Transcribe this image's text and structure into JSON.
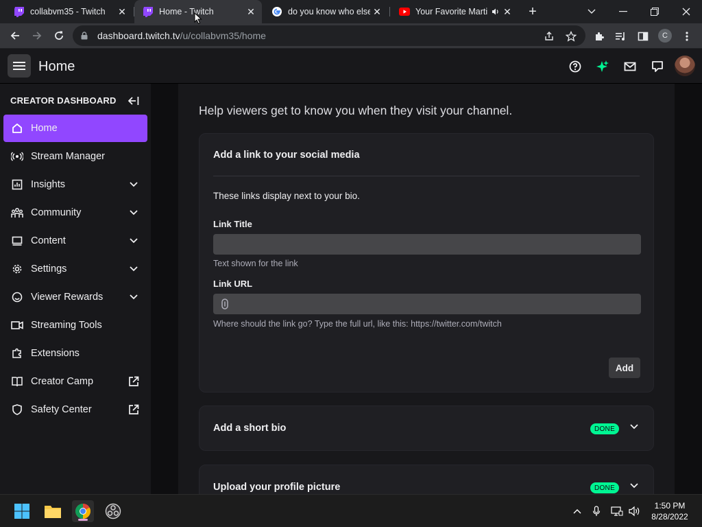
{
  "browser": {
    "tabs": [
      {
        "title": "collabvm35 - Twitch",
        "favicon": "twitch-icon",
        "active": false
      },
      {
        "title": "Home - Twitch",
        "favicon": "twitch-icon",
        "active": true
      },
      {
        "title": "do you know who else",
        "favicon": "google-icon",
        "active": false
      },
      {
        "title": "Your Favorite Marti",
        "favicon": "youtube-icon",
        "active": false
      }
    ],
    "url_host": "dashboard.twitch.tv",
    "url_path": "/u/collabvm35/home",
    "profile_initial": "C"
  },
  "topnav": {
    "title": "Home"
  },
  "sidebar": {
    "header": "CREATOR DASHBOARD",
    "items": [
      {
        "label": "Home",
        "icon": "home-icon",
        "active": true,
        "trailing": "none"
      },
      {
        "label": "Stream Manager",
        "icon": "broadcast-icon",
        "active": false,
        "trailing": "none"
      },
      {
        "label": "Insights",
        "icon": "insights-icon",
        "active": false,
        "trailing": "chevron"
      },
      {
        "label": "Community",
        "icon": "community-icon",
        "active": false,
        "trailing": "chevron"
      },
      {
        "label": "Content",
        "icon": "content-icon",
        "active": false,
        "trailing": "chevron"
      },
      {
        "label": "Settings",
        "icon": "gear-icon",
        "active": false,
        "trailing": "chevron"
      },
      {
        "label": "Viewer Rewards",
        "icon": "rewards-icon",
        "active": false,
        "trailing": "chevron"
      },
      {
        "label": "Streaming Tools",
        "icon": "camera-icon",
        "active": false,
        "trailing": "none"
      },
      {
        "label": "Extensions",
        "icon": "puzzle-icon",
        "active": false,
        "trailing": "none"
      },
      {
        "label": "Creator Camp",
        "icon": "book-icon",
        "active": false,
        "trailing": "external"
      },
      {
        "label": "Safety Center",
        "icon": "shield-icon",
        "active": false,
        "trailing": "external"
      }
    ]
  },
  "main": {
    "intro": "Help viewers get to know you when they visit your channel.",
    "social_card": {
      "title": "Add a link to your social media",
      "description": "These links display next to your bio.",
      "link_title_label": "Link Title",
      "link_title_value": "",
      "link_title_help": "Text shown for the link",
      "link_url_label": "Link URL",
      "link_url_value": "",
      "link_url_help": "Where should the link go? Type the full url, like this: https://twitter.com/twitch",
      "add_button": "Add"
    },
    "bio_card": {
      "title": "Add a short bio",
      "badge": "DONE"
    },
    "picture_card": {
      "title": "Upload your profile picture",
      "badge": "DONE"
    }
  },
  "taskbar": {
    "time": "1:50 PM",
    "date": "8/28/2022"
  },
  "colors": {
    "accent": "#9147ff",
    "done_badge": "#00f593",
    "background": "#0e0e10",
    "surface": "#18181b"
  }
}
